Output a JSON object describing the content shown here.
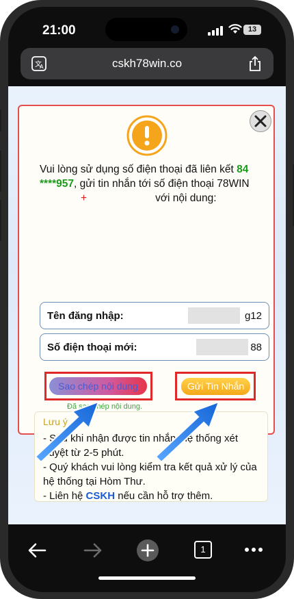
{
  "status_bar": {
    "time": "21:00",
    "battery": "13"
  },
  "browser": {
    "url": "cskh78win.co"
  },
  "dialog": {
    "message": {
      "part1": "Vui lòng sử dụng số điện thoại đã liên kết ",
      "phone_masked": "84 ****957",
      "part2": ", gửi tin nhắn tới số điện thoại 78WIN",
      "plus": "+",
      "part3": "với nội dung:"
    },
    "username_label": "Tên đăng nhập:",
    "username_value": "g12",
    "phone_label": "Số điện thoại mới:",
    "phone_value": "88",
    "copy_button": "Sao chép nội dung",
    "copied_text": "Đã sao chép nội dung.",
    "send_button": "Gửi Tin Nhắn",
    "note": {
      "title": "Lưu ý",
      "line1": "- Sau khi nhận được tin nhắn, hệ thống xét duyệt từ 2-5 phút.",
      "line2": "- Quý khách vui lòng kiểm tra kết quả xử lý của hệ thống tại Hòm Thư.",
      "line3_prefix": "- Liên hệ ",
      "line3_link": "CSKH",
      "line3_suffix": " nếu cần hỗ trợ thêm."
    }
  },
  "toolbar": {
    "tabs_count": "1"
  },
  "colors": {
    "accent_red": "#e02828",
    "warning_orange": "#f4a51c",
    "link_blue": "#1a5cd6",
    "green": "#1a9b1a"
  }
}
